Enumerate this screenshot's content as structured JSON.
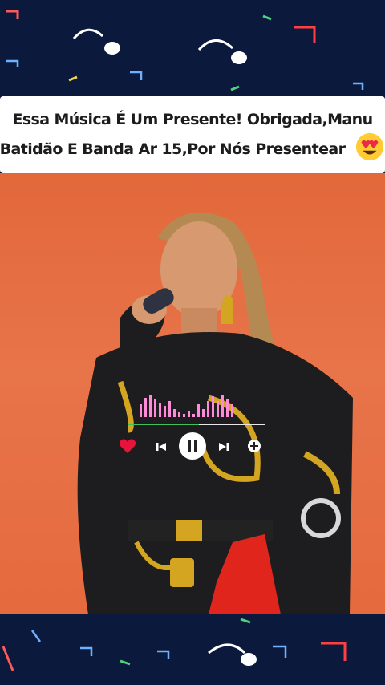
{
  "caption": {
    "line1": "Essa Música É Um Presente! Obrigada,Manu",
    "line2": "Batidão E Banda Ar 15,Por Nós Presentear",
    "emoji": "heart-eyes-emoji"
  },
  "player": {
    "progress": 0.52,
    "colors": {
      "wave": "#ff8ad8",
      "progress": "#3fc060",
      "heart": "#e8123a"
    },
    "icons": [
      "heart-icon",
      "previous-icon",
      "pause-icon",
      "next-icon",
      "add-icon"
    ]
  },
  "colors": {
    "band": "#0b1a3c",
    "stage": "#e56a3e",
    "caption_bg": "#ffffff"
  }
}
